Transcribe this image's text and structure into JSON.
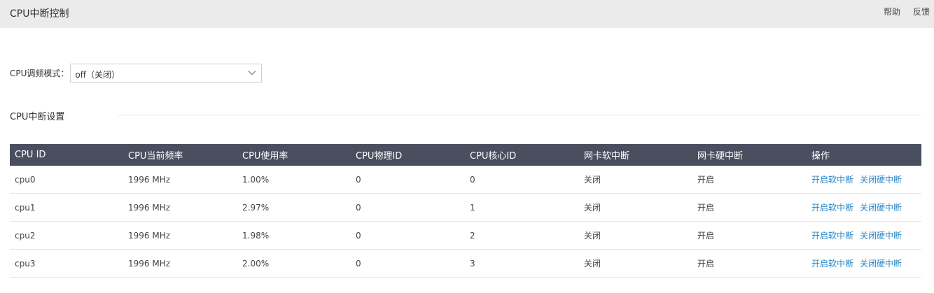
{
  "header": {
    "title": "CPU中断控制",
    "help": "帮助",
    "feedback": "反馈"
  },
  "mode": {
    "label": "CPU调频模式：",
    "value": "off（关闭）",
    "chevron_icon": "chevron-down-icon"
  },
  "section": {
    "title": "CPU中断设置"
  },
  "table": {
    "headers": [
      "CPU ID",
      "CPU当前频率",
      "CPU使用率",
      "CPU物理ID",
      "CPU核心ID",
      "网卡软中断",
      "网卡硬中断",
      "操作"
    ],
    "rows": [
      {
        "id": "cpu0",
        "freq": "1996 MHz",
        "usage": "1.00%",
        "phys": "0",
        "core": "0",
        "soft": "关闭",
        "hard": "开启",
        "op_soft": "开启软中断",
        "op_hard": "关闭硬中断"
      },
      {
        "id": "cpu1",
        "freq": "1996 MHz",
        "usage": "2.97%",
        "phys": "0",
        "core": "1",
        "soft": "关闭",
        "hard": "开启",
        "op_soft": "开启软中断",
        "op_hard": "关闭硬中断"
      },
      {
        "id": "cpu2",
        "freq": "1996 MHz",
        "usage": "1.98%",
        "phys": "0",
        "core": "2",
        "soft": "关闭",
        "hard": "开启",
        "op_soft": "开启软中断",
        "op_hard": "关闭硬中断"
      },
      {
        "id": "cpu3",
        "freq": "1996 MHz",
        "usage": "2.00%",
        "phys": "0",
        "core": "3",
        "soft": "关闭",
        "hard": "开启",
        "op_soft": "开启软中断",
        "op_hard": "关闭硬中断"
      }
    ]
  },
  "colors": {
    "header_bg": "#4a4f60",
    "status_off": "#e05a5a",
    "status_on": "#3cb57a",
    "link": "#2a87c9"
  }
}
